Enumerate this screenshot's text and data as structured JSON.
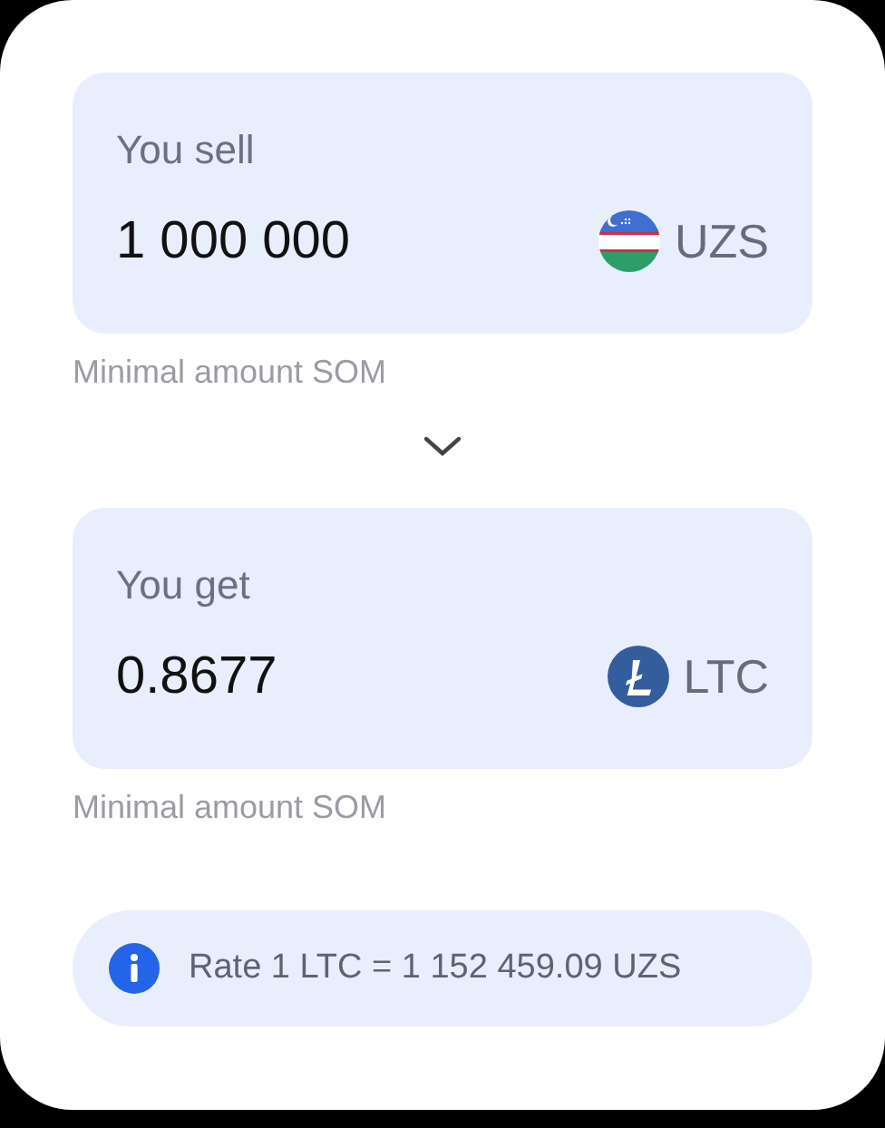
{
  "exchange": [
    {
      "label": "You sell",
      "amount": "1 000 000",
      "currency": {
        "kind": "flag",
        "code": "UZS"
      },
      "hint": "Minimal amount SOM"
    },
    {
      "label": "You get",
      "amount": "0.8677",
      "currency": {
        "kind": "coin",
        "code": "LTC"
      },
      "hint": "Minimal amount SOM"
    }
  ],
  "rate": "Rate 1 LTC = 1 152 459.09 UZS"
}
